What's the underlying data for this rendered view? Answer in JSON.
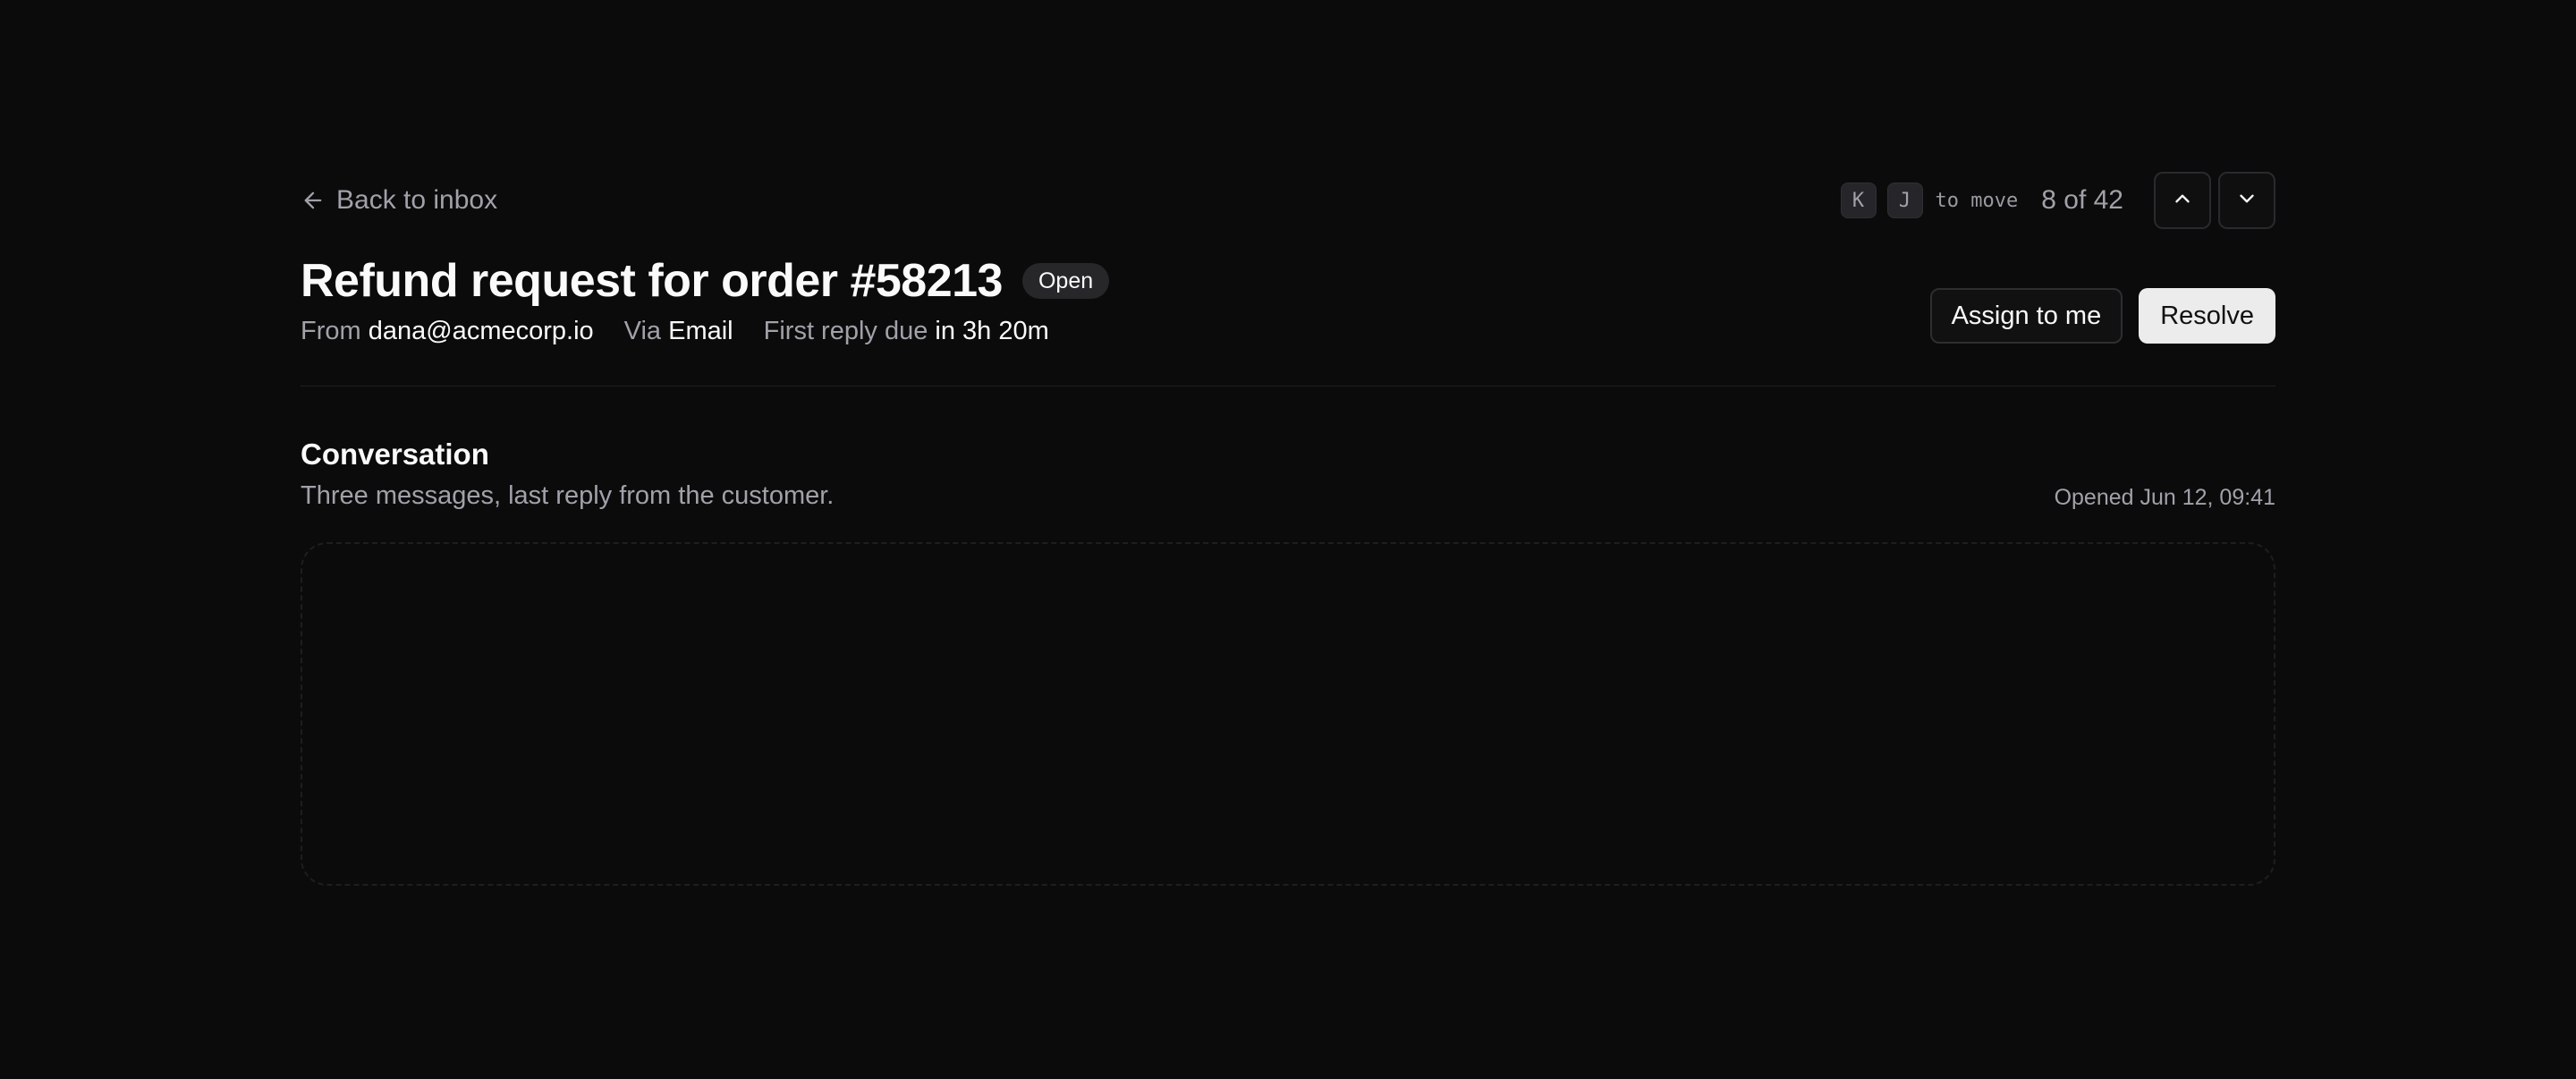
{
  "nav": {
    "back_label": "Back to inbox",
    "shortcut_keys": [
      "K",
      "J"
    ],
    "shortcut_hint": "to move",
    "position": "8 of 42",
    "prev_icon": "chevron-up-icon",
    "next_icon": "chevron-down-icon",
    "back_icon": "arrow-left-icon"
  },
  "ticket": {
    "title": "Refund request for order #58213",
    "status": "Open",
    "meta": {
      "from_label": "From",
      "from_value": "dana@acmecorp.io",
      "via_label": "Via",
      "via_value": "Email",
      "due_label": "First reply due",
      "due_value": "in 3h 20m"
    }
  },
  "actions": {
    "assign_label": "Assign to me",
    "resolve_label": "Resolve"
  },
  "conversation": {
    "title": "Conversation",
    "subtitle": "Three messages, last reply from the customer.",
    "opened": "Opened Jun 12, 09:41"
  },
  "colors": {
    "background": "#0b0b0b",
    "primary_button": "#ececed",
    "muted_text": "#a1a1aa"
  }
}
